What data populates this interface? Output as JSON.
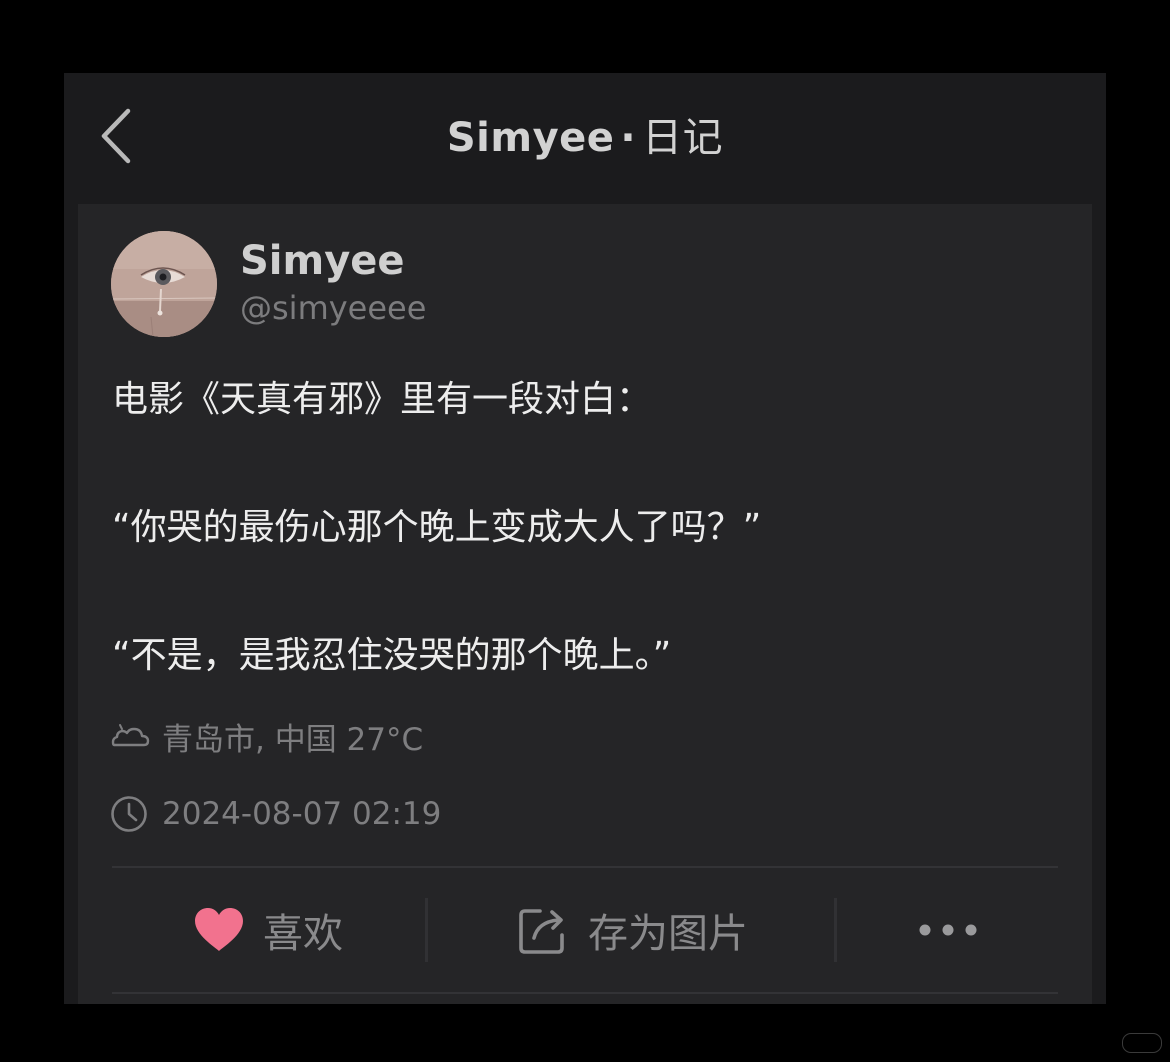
{
  "nav": {
    "title_user": "Simyee",
    "title_separator": "·",
    "title_section": "日记"
  },
  "author": {
    "name": "Simyee",
    "handle": "@simyeeee"
  },
  "post": {
    "lines": [
      "电影《天真有邪》里有一段对白：",
      "“你哭的最伤心那个晚上变成大人了吗？”",
      "“不是，是我忍住没哭的那个晚上。”"
    ]
  },
  "meta": {
    "weather_icon": "cloud-icon",
    "location_weather": "青岛市, 中国 27°C",
    "time_icon": "clock-icon",
    "timestamp": "2024-08-07 02:19"
  },
  "actions": {
    "like_label": "喜欢",
    "like_icon": "heart-icon",
    "save_label": "存为图片",
    "save_icon": "share-export-icon",
    "more_icon": "more-dots-icon"
  },
  "colors": {
    "page_background": "#000000",
    "screen_background": "#1b1b1d",
    "card_background": "#252527",
    "heart": "#f2728e"
  }
}
